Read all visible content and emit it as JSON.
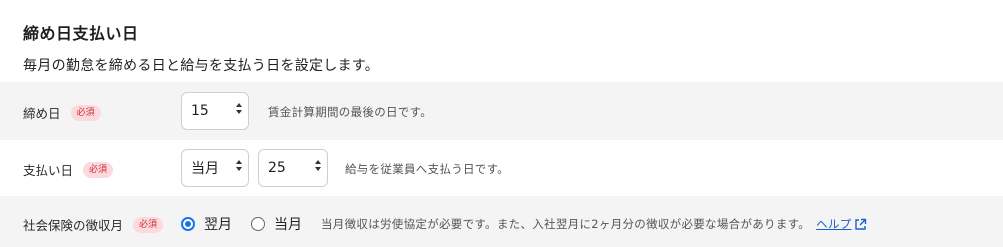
{
  "section": {
    "title": "締め日支払い日",
    "description": "毎月の勤怠を締める日と給与を支払う日を設定します。"
  },
  "rows": {
    "closing_day": {
      "label": "締め日",
      "badge": "必須",
      "select_value": "15",
      "hint": "賃金計算期間の最後の日です。"
    },
    "pay_day": {
      "label": "支払い日",
      "badge": "必須",
      "month_select_value": "当月",
      "day_select_value": "25",
      "hint": "給与を従業員へ支払う日です。"
    },
    "social_insurance": {
      "label": "社会保険の徴収月",
      "badge": "必須",
      "options": [
        "翌月",
        "当月"
      ],
      "selected": "翌月",
      "hint": "当月徴収は労使協定が必要です。また、入社翌月に2ヶ月分の徴収が必要な場合があります。",
      "help_link": "ヘルプ"
    }
  },
  "colors": {
    "badge_bg": "#fbd9dc",
    "badge_text": "#cc2e3b",
    "accent": "#1a73e8",
    "row_shade": "#f5f4f4"
  },
  "icons": {
    "help": "external-link-icon",
    "select": "up-down-arrows-icon"
  }
}
